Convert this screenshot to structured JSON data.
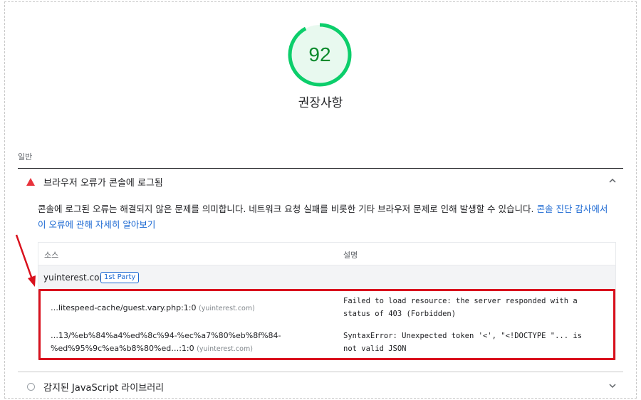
{
  "score": {
    "value": "92",
    "fraction": 0.92,
    "title": "권장사항",
    "color": "#0cce6b"
  },
  "section_label": "일반",
  "audit": {
    "status_icon": "red-triangle-icon",
    "title": "브라우저 오류가 콘솔에 로그됨",
    "expand_icon": "chevron-up-icon",
    "description": "콘솔에 로그된 오류는 해결되지 않은 문제를 의미합니다. 네트워크 요청 실패를 비롯한 기타 브라우저 문제로 인해 발생할 수 있습니다.",
    "link_text": "콘솔 진단 감사에서 이 오류에 관해 자세히 알아보기",
    "link_color": "#1967d2"
  },
  "table": {
    "headers": {
      "source": "소스",
      "description": "설명"
    },
    "group": {
      "domain": "yuinterest.com",
      "badge": "1st Party"
    },
    "rows": [
      {
        "source": "…litespeed-cache/guest.vary.php:1:0",
        "origin": "(yuinterest.com)",
        "message": "Failed to load resource: the server responded with a status of 403 (Forbidden)"
      },
      {
        "source_line1": "…13/%eb%84%a4%ed%8c%94-%ec%a7%80%eb%8f%84-",
        "source_line2": "%ed%95%9c%ea%b8%80%ed…:1:0",
        "origin": "(yuinterest.com)",
        "message": "SyntaxError: Unexpected token '<', \"<!DOCTYPE \"... is not valid JSON"
      }
    ]
  },
  "audit2": {
    "status_icon": "grey-circle-icon",
    "title": "감지된 JavaScript 라이브러리",
    "expand_icon": "chevron-down-icon"
  },
  "annotation": {
    "color": "#d9111d"
  }
}
